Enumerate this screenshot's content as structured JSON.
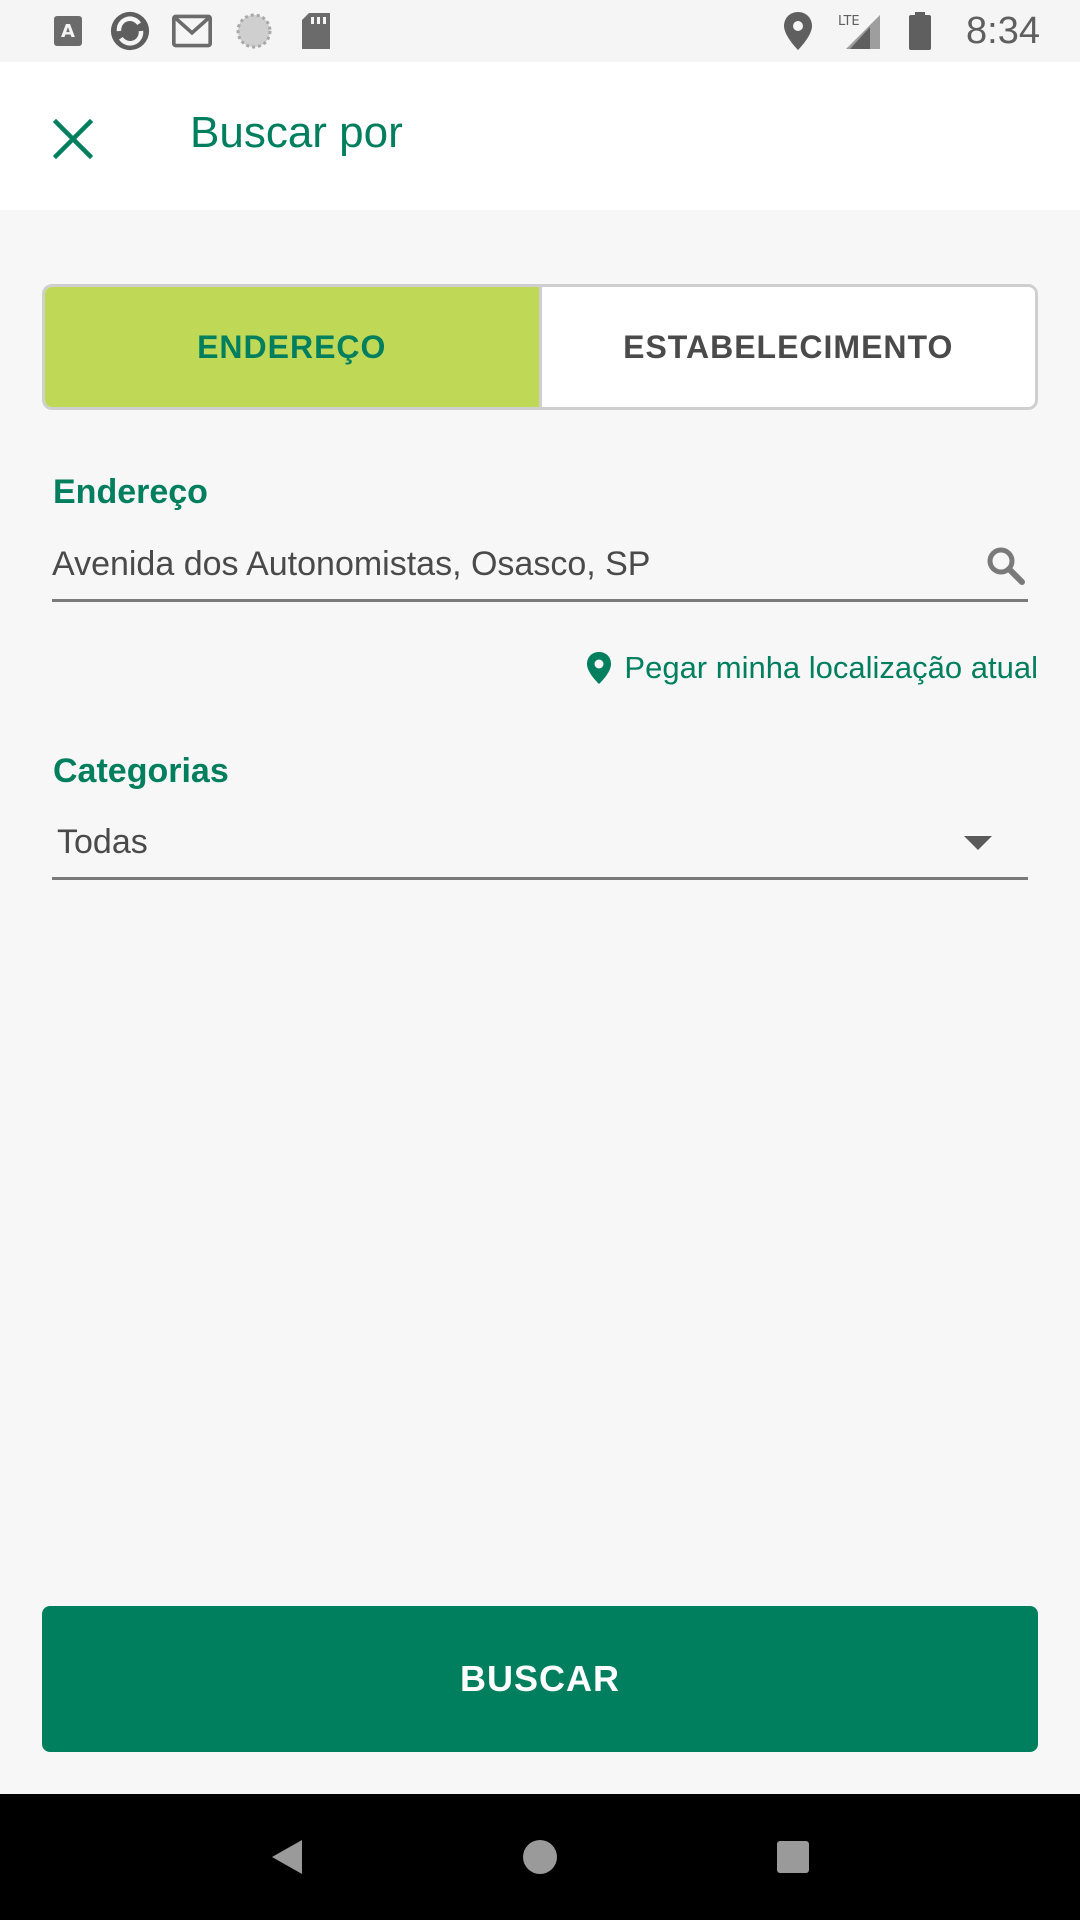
{
  "status_bar": {
    "time": "8:34",
    "network": "LTE",
    "left_icons": [
      "font-download-icon",
      "sync-app-icon",
      "gmail-icon",
      "loading-icon",
      "sd-card-icon"
    ],
    "right_icons": [
      "location-icon",
      "signal-icon",
      "battery-icon"
    ]
  },
  "header": {
    "title": "Buscar por"
  },
  "search_mode": {
    "tabs": [
      {
        "label": "ENDEREÇO",
        "active": true
      },
      {
        "label": "ESTABELECIMENTO",
        "active": false
      }
    ]
  },
  "address": {
    "label": "Endereço",
    "value": "Avenida dos Autonomistas, Osasco, SP"
  },
  "location_link": {
    "label": "Pegar minha localização atual"
  },
  "categories": {
    "label": "Categorias",
    "selected": "Todas"
  },
  "submit": {
    "label": "BUSCAR"
  },
  "colors": {
    "primary": "#007f5f",
    "accent": "#bfd957",
    "background": "#f7f7f7"
  }
}
